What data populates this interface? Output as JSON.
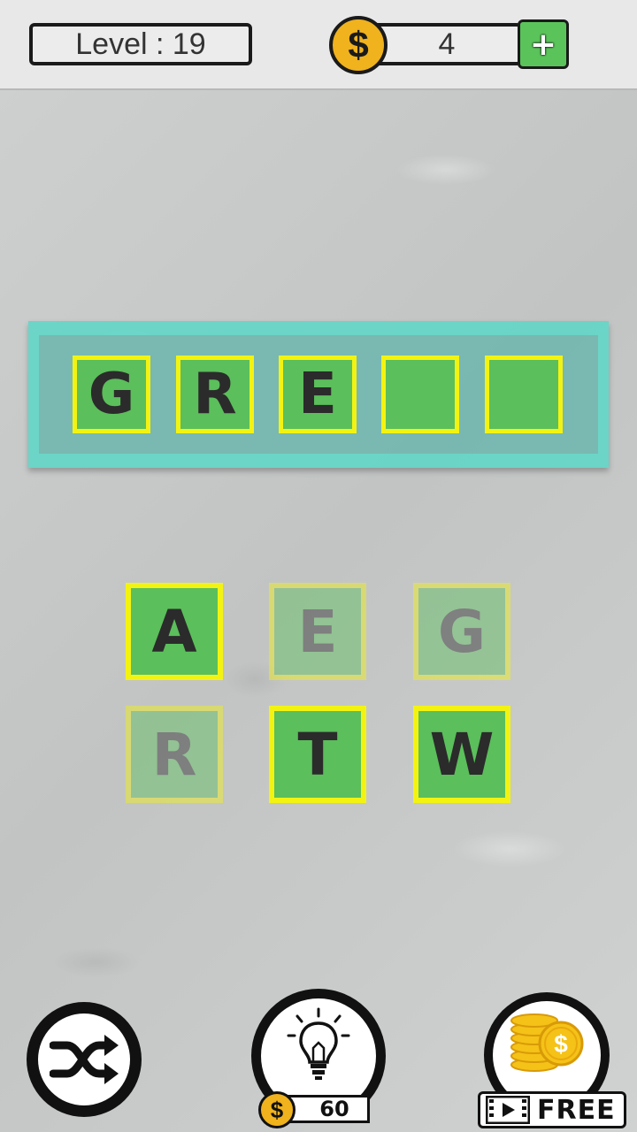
{
  "header": {
    "level_text": "Level : 19",
    "coins": "4",
    "coin_symbol": "$",
    "add_coins_icon": "plus-icon"
  },
  "answer": {
    "slots": [
      "G",
      "R",
      "E",
      "",
      ""
    ]
  },
  "letters": [
    {
      "letter": "A",
      "used": false
    },
    {
      "letter": "E",
      "used": true
    },
    {
      "letter": "G",
      "used": true
    },
    {
      "letter": "R",
      "used": true
    },
    {
      "letter": "T",
      "used": false
    },
    {
      "letter": "W",
      "used": false
    }
  ],
  "controls": {
    "shuffle_icon": "shuffle-icon",
    "hint_icon": "lightbulb-icon",
    "hint_cost": "60",
    "hint_coin_symbol": "$",
    "free_icon": "gold-coins-icon",
    "free_video_icon": "video-icon",
    "free_label": "FREE"
  },
  "colors": {
    "tile_green": "#5bbf5b",
    "tile_border": "#f3f312",
    "panel_teal": "#62d6c6",
    "coin_gold": "#f0b21d"
  }
}
